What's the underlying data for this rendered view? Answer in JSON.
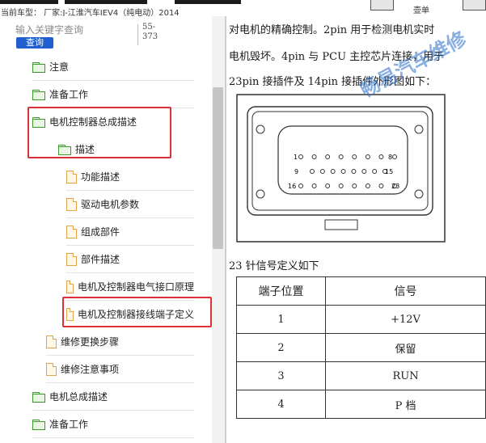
{
  "topbar": {
    "vehicle_info": "当前车型： 厂家:J-江淮汽车IEV4（纯电动）2014",
    "tool_label": "壶单"
  },
  "search": {
    "placeholder": "输入关键字查询",
    "button": "查询",
    "range_start": "55-",
    "range_end": "373"
  },
  "tree": {
    "items": [
      {
        "label": "注意",
        "icon": "folder-icon"
      },
      {
        "label": "准备工作",
        "icon": "folder-icon"
      },
      {
        "label": "电机控制器总成描述",
        "icon": "folder-open-icon"
      },
      {
        "label": "描述",
        "icon": "folder-open-icon"
      },
      {
        "label": "功能描述",
        "icon": "document-icon"
      },
      {
        "label": "驱动电机参数",
        "icon": "document-icon"
      },
      {
        "label": "组成部件",
        "icon": "document-icon"
      },
      {
        "label": "部件描述",
        "icon": "document-icon"
      },
      {
        "label": "电机及控制器电气接口原理",
        "icon": "document-icon"
      },
      {
        "label": "电机及控制器接线端子定义",
        "icon": "document-icon"
      },
      {
        "label": "维修更换步骤",
        "icon": "document-icon"
      },
      {
        "label": "维修注意事项",
        "icon": "document-icon"
      },
      {
        "label": "电机总成描述",
        "icon": "folder-icon"
      },
      {
        "label": "准备工作",
        "icon": "folder-icon"
      }
    ]
  },
  "document": {
    "line1": "对电机的精确控制。2pin 用于检测电机实时",
    "line2": "电机毁坏。4pin 与 PCU 主控芯片连接，用于",
    "line3": "23pin 接插件及 14pin 接插件外形图如下：",
    "pin_labels": [
      "1",
      "8",
      "9",
      "15",
      "16",
      "23"
    ],
    "table_caption": "23 针信号定义如下",
    "watermark": "畅易汽车维修",
    "table": {
      "headers": [
        "端子位置",
        "信号"
      ],
      "rows": [
        [
          "1",
          "+12V"
        ],
        [
          "2",
          "保留"
        ],
        [
          "3",
          "RUN"
        ],
        [
          "4",
          "P 档"
        ]
      ]
    }
  },
  "colors": {
    "highlight": "#e0303a",
    "search_button": "#1f5fd0",
    "folder": "#3a9a2e",
    "document": "#e0a34a"
  }
}
